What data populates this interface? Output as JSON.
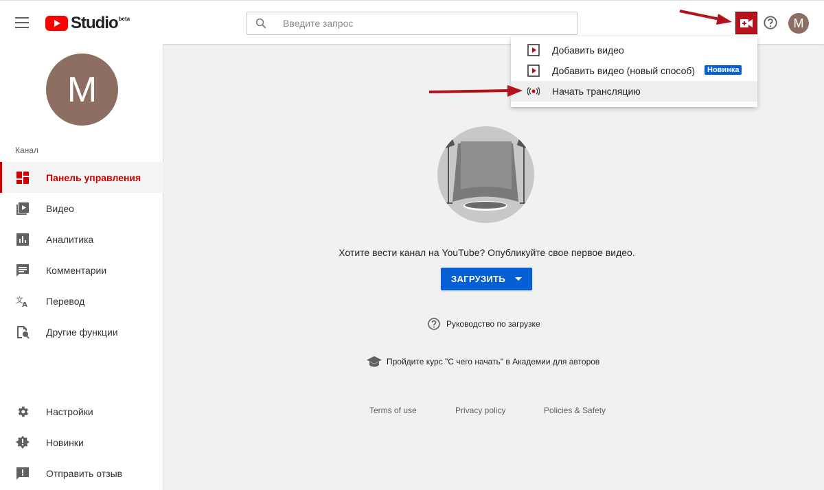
{
  "header": {
    "logo_text": "Studio",
    "logo_badge": "beta",
    "search_placeholder": "Введите запрос",
    "avatar_letter": "M"
  },
  "sidebar": {
    "avatar_letter": "M",
    "section_title": "Канал",
    "items": [
      {
        "label": "Панель управления",
        "icon": "dashboard-icon",
        "active": true
      },
      {
        "label": "Видео",
        "icon": "video-library-icon"
      },
      {
        "label": "Аналитика",
        "icon": "analytics-icon"
      },
      {
        "label": "Комментарии",
        "icon": "comments-icon"
      },
      {
        "label": "Перевод",
        "icon": "translate-icon"
      },
      {
        "label": "Другие функции",
        "icon": "other-features-icon"
      }
    ],
    "bottom_items": [
      {
        "label": "Настройки",
        "icon": "gear-icon"
      },
      {
        "label": "Новинки",
        "icon": "whats-new-icon"
      },
      {
        "label": "Отправить отзыв",
        "icon": "feedback-icon"
      }
    ]
  },
  "main": {
    "prompt": "Хотите вести канал на YouTube? Опубликуйте свое первое видео.",
    "upload_button": "ЗАГРУЗИТЬ",
    "guide_link": "Руководство по загрузке",
    "course_link": "Пройдите курс \"С чего начать\" в Академии для авторов",
    "footer": [
      "Terms of use",
      "Privacy policy",
      "Policies & Safety"
    ]
  },
  "menu": {
    "items": [
      {
        "label": "Добавить видео",
        "icon": "upload-video-icon"
      },
      {
        "label": "Добавить видео (новый способ)",
        "icon": "upload-video-icon",
        "badge": "Новинка"
      },
      {
        "label": "Начать трансляцию",
        "icon": "live-stream-icon"
      }
    ]
  },
  "colors": {
    "accent_red": "#cc0000",
    "brand_blue": "#065fd4",
    "create_button": "#b5121b"
  }
}
